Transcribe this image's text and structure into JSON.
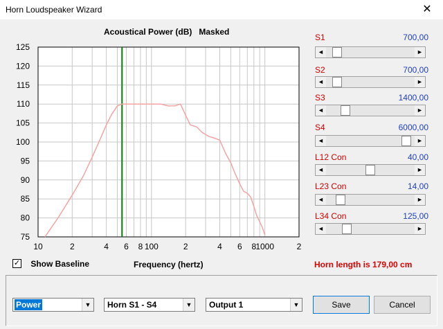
{
  "window": {
    "title": "Horn Loudspeaker Wizard",
    "close_glyph": "✕"
  },
  "chart_header": "Acoustical Power (dB)   Masked",
  "chart_data": {
    "type": "line",
    "title": "Acoustical Power (dB)   Masked",
    "xlabel": "Frequency (hertz)",
    "ylabel": "",
    "x_scale": "log",
    "xlim": [
      10,
      2000
    ],
    "ylim": [
      75,
      125
    ],
    "yticks": [
      75,
      80,
      85,
      90,
      95,
      100,
      105,
      110,
      115,
      120,
      125
    ],
    "xtick_labels": [
      {
        "x": 10,
        "label": "10"
      },
      {
        "x": 20,
        "label": "2"
      },
      {
        "x": 40,
        "label": "4"
      },
      {
        "x": 60,
        "label": "6"
      },
      {
        "x": 80,
        "label": "8"
      },
      {
        "x": 100,
        "label": "100"
      },
      {
        "x": 200,
        "label": "2"
      },
      {
        "x": 400,
        "label": "4"
      },
      {
        "x": 600,
        "label": "6"
      },
      {
        "x": 800,
        "label": "8"
      },
      {
        "x": 1000,
        "label": "1000"
      },
      {
        "x": 2000,
        "label": "2"
      }
    ],
    "grid": true,
    "marker_line": {
      "x": 55,
      "color": "#008000"
    },
    "series": [
      {
        "color": "#f5a3a3",
        "x": [
          11.5,
          15,
          20,
          25,
          30,
          35,
          40,
          45,
          50,
          55,
          60,
          70,
          80,
          90,
          100,
          110,
          120,
          140,
          160,
          180,
          200,
          220,
          250,
          280,
          320,
          360,
          400,
          450,
          500,
          550,
          600,
          650,
          700,
          750,
          800,
          850,
          900,
          950,
          1000
        ],
        "y": [
          75,
          80,
          86,
          91,
          96,
          100.5,
          104.5,
          107.5,
          109.5,
          110,
          110,
          110,
          110,
          110,
          110,
          110,
          110,
          109.5,
          109.5,
          110,
          107,
          104.5,
          104,
          102.5,
          101.5,
          101,
          100.5,
          97,
          94.5,
          91.5,
          89,
          87,
          86.5,
          85.5,
          83,
          80.5,
          79,
          77.5,
          75.5
        ]
      }
    ]
  },
  "sliders": [
    {
      "label": "S1",
      "value": "700,00",
      "fraction": 0.08
    },
    {
      "label": "S2",
      "value": "700,00",
      "fraction": 0.08
    },
    {
      "label": "S3",
      "value": "1400,00",
      "fraction": 0.18
    },
    {
      "label": "S4",
      "value": "6000,00",
      "fraction": 0.96
    },
    {
      "label": "L12  Con",
      "value": "40,00",
      "fraction": 0.5
    },
    {
      "label": "L23  Con",
      "value": "14,00",
      "fraction": 0.12
    },
    {
      "label": "L34  Con",
      "value": "125,00",
      "fraction": 0.2
    }
  ],
  "baseline": {
    "checked_glyph": "✓",
    "label": "Show Baseline"
  },
  "xaxis_label": "Frequency (hertz)",
  "horn_length": "Horn length is 179,00 cm",
  "combos": {
    "mode": "Power",
    "horn": "Horn S1 - S4",
    "output": "Output 1",
    "arrow_glyph": "▼"
  },
  "buttons": {
    "save": "Save",
    "cancel": "Cancel"
  },
  "icons": {
    "arrow_left": "◄",
    "arrow_right": "►"
  }
}
